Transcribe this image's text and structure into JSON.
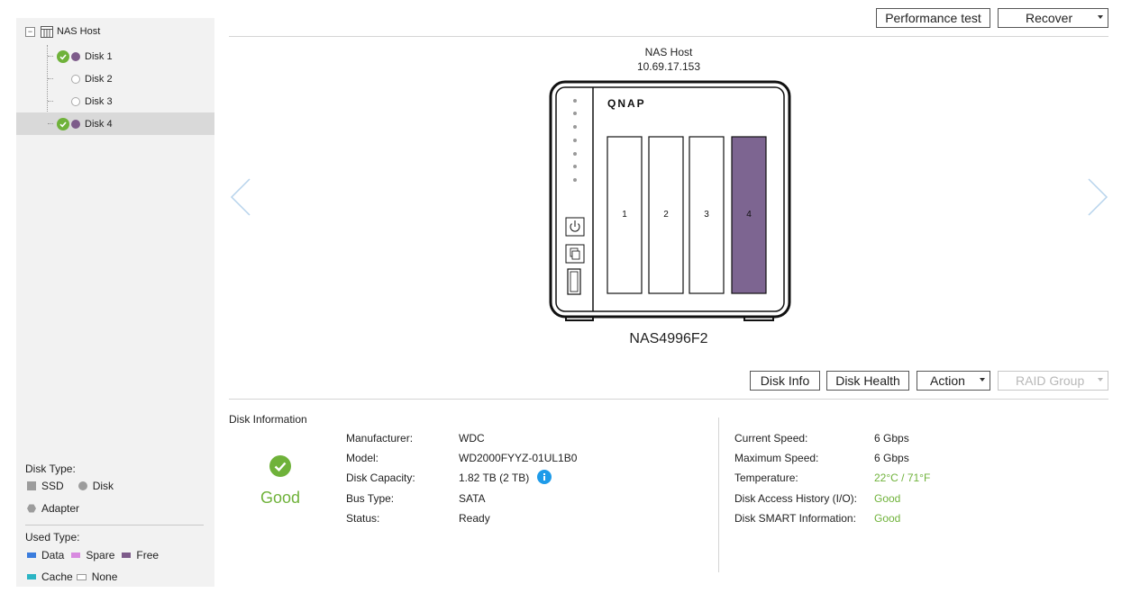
{
  "tree": {
    "root_label": "NAS Host",
    "items": [
      {
        "label": "Disk 1",
        "checked": true,
        "filled": true,
        "selected": false
      },
      {
        "label": "Disk 2",
        "checked": false,
        "filled": false,
        "selected": false
      },
      {
        "label": "Disk 3",
        "checked": false,
        "filled": false,
        "selected": false
      },
      {
        "label": "Disk 4",
        "checked": true,
        "filled": true,
        "selected": true
      }
    ]
  },
  "legend": {
    "disk_type_title": "Disk Type:",
    "disk_types": [
      "SSD",
      "Disk",
      "Adapter"
    ],
    "used_type_title": "Used Type:",
    "used_types": [
      {
        "label": "Data",
        "color": "#3b7ddd"
      },
      {
        "label": "Spare",
        "color": "#d88ae0"
      },
      {
        "label": "Free",
        "color": "#7d5b8a"
      },
      {
        "label": "Cache",
        "color": "#2bb5c4"
      },
      {
        "label": "None",
        "color": "#ffffff"
      }
    ]
  },
  "toolbar_top": {
    "performance_test": "Performance test",
    "recover": "Recover"
  },
  "device": {
    "host_name": "NAS Host",
    "ip": "10.69.17.153",
    "brand": "QNAP",
    "model_name": "NAS4996F2",
    "bays": [
      "1",
      "2",
      "3",
      "4"
    ],
    "selected_bay_color": "#7d6591"
  },
  "toolbar_disk": {
    "disk_info": "Disk Info",
    "disk_health": "Disk Health",
    "action": "Action",
    "raid_group": "RAID Group"
  },
  "disk_info": {
    "heading": "Disk Information",
    "overall_status": "Good",
    "left": [
      {
        "label": "Manufacturer:",
        "value": "WDC"
      },
      {
        "label": "Model:",
        "value": "WD2000FYYZ-01UL1B0"
      },
      {
        "label": "Disk Capacity:",
        "value": "1.82 TB (2 TB)"
      },
      {
        "label": "Bus Type:",
        "value": "SATA"
      },
      {
        "label": "Status:",
        "value": "Ready"
      }
    ],
    "right": [
      {
        "label": "Current Speed:",
        "value": "6 Gbps"
      },
      {
        "label": "Maximum Speed:",
        "value": "6 Gbps"
      },
      {
        "label": "Temperature:",
        "value": "22°C / 71°F"
      },
      {
        "label": "Disk Access History (I/O):",
        "value": "Good"
      },
      {
        "label": "Disk SMART Information:",
        "value": "Good"
      }
    ]
  },
  "colors": {
    "good": "#6fb23a",
    "info_icon": "#1e9be9"
  }
}
